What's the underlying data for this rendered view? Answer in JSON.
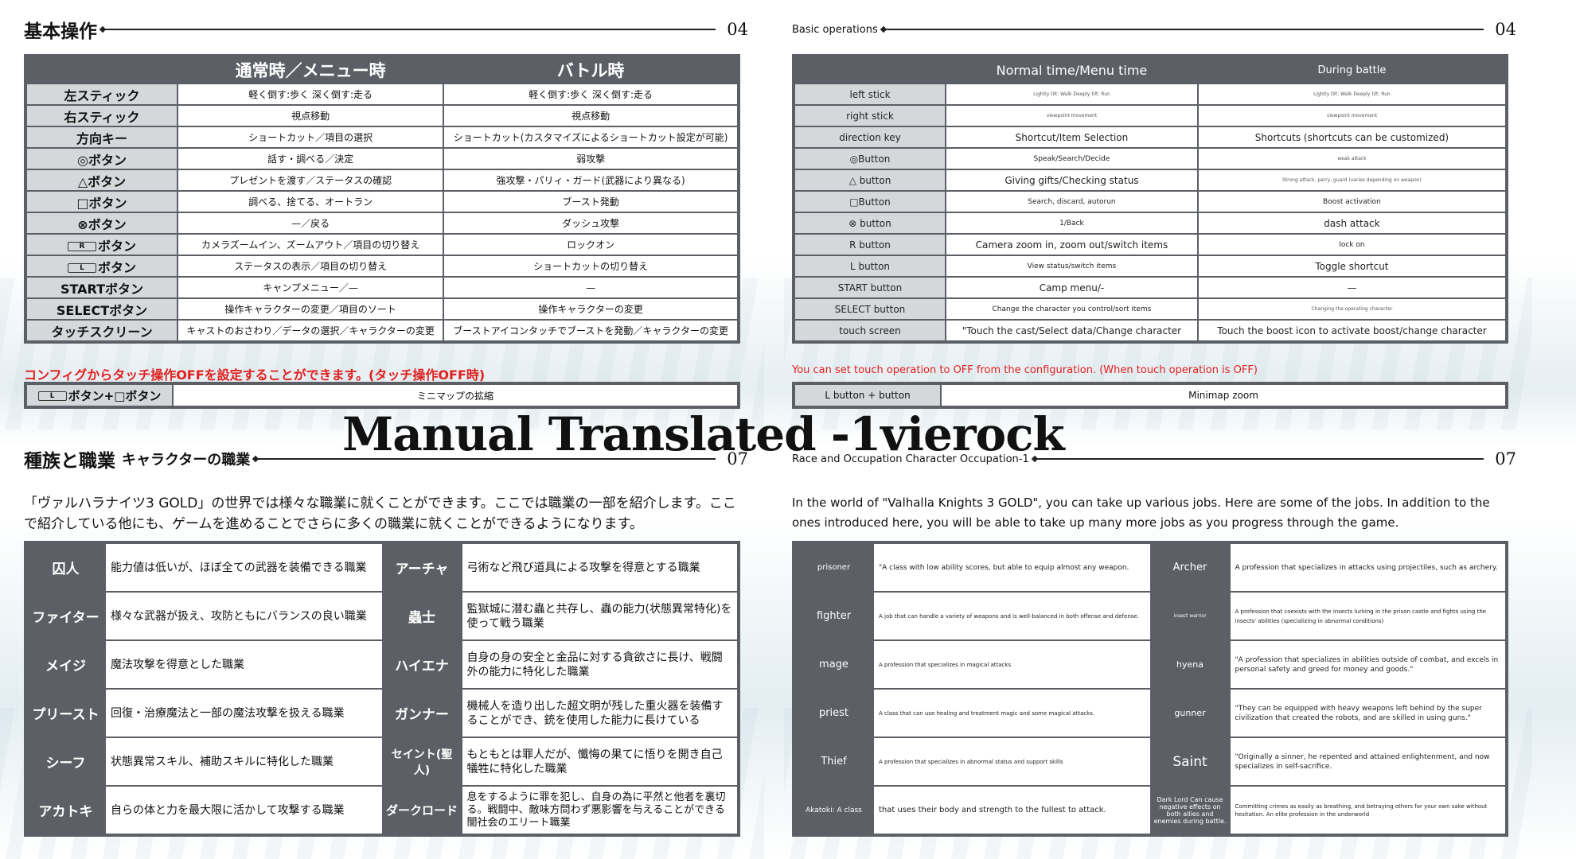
{
  "jp_ops": {
    "title": "基本操作",
    "page": "04",
    "col_normal": "通常時／メニュー時",
    "col_battle": "バトル時",
    "rows": [
      {
        "key": "左スティック",
        "normal": "軽く倒す:歩く 深く倒す:走る",
        "battle": "軽く倒す:歩く 深く倒す:走る"
      },
      {
        "key": "右スティック",
        "normal": "視点移動",
        "battle": "視点移動"
      },
      {
        "key": "方向キー",
        "normal": "ショートカット／項目の選択",
        "battle": "ショートカット(カスタマイズによるショートカット設定が可能)"
      },
      {
        "key": "◎ボタン",
        "normal": "話す・調べる／決定",
        "battle": "弱攻撃"
      },
      {
        "key": "△ボタン",
        "normal": "プレゼントを渡す／ステータスの確認",
        "battle": "強攻撃・パリィ・ガード(武器により異なる)"
      },
      {
        "key": "□ボタン",
        "normal": "調べる、捨てる、オートラン",
        "battle": "ブースト発動"
      },
      {
        "key": "⊗ボタン",
        "normal": "—／戻る",
        "battle": "ダッシュ攻撃"
      },
      {
        "key": "ボタン",
        "normal": "カメラズームイン、ズームアウト／項目の切り替え",
        "battle": "ロックオン"
      },
      {
        "key": "ボタン",
        "normal": "ステータスの表示／項目の切り替え",
        "battle": "ショートカットの切り替え"
      },
      {
        "key": "STARTボタン",
        "normal": "キャンプメニュー／—",
        "battle": "—"
      },
      {
        "key": "SELECTボタン",
        "normal": "操作キャラクターの変更／項目のソート",
        "battle": "操作キャラクターの変更"
      },
      {
        "key": "タッチスクリーン",
        "normal": "キャストのおさわり／データの選択／キャラクターの変更",
        "battle": "ブーストアイコンタッチでブーストを発動／キャラクターの変更"
      }
    ],
    "btn_r": "R",
    "btn_l": "L",
    "note": "コンフィグからタッチ操作OFFを設定することができます。(タッチ操作OFF時)",
    "extra_key": "ボタン+□ボタン",
    "extra_val": "ミニマップの拡縮"
  },
  "en_ops": {
    "title": "Basic operations",
    "page": "04",
    "col_normal": "Normal time/Menu time",
    "col_battle": "During battle",
    "rows": [
      {
        "key": "left stick",
        "normal": "Lightly tilt: Walk Deeply tilt: Run",
        "battle": "Lightly tilt: Walk Deeply tilt: Run"
      },
      {
        "key": "right stick",
        "normal": "viewpoint movement",
        "battle": "viewpoint movement"
      },
      {
        "key": "direction key",
        "normal": "Shortcut/Item Selection",
        "battle": "Shortcuts (shortcuts can be customized)"
      },
      {
        "key": "◎Button",
        "normal": "Speak/Search/Decide",
        "battle": "weak attack"
      },
      {
        "key": "△ button",
        "normal": "Giving gifts/Checking status",
        "battle": "Strong attack, parry, guard (varies depending on weapon)"
      },
      {
        "key": "□Button",
        "normal": "Search, discard, autorun",
        "battle": "Boost activation"
      },
      {
        "key": "⊗ button",
        "normal": "1/Back",
        "battle": "dash attack"
      },
      {
        "key": "R button",
        "normal": "Camera zoom in, zoom out/switch items",
        "battle": "lock on"
      },
      {
        "key": "L button",
        "normal": "View status/switch items",
        "battle": "Toggle shortcut"
      },
      {
        "key": "START button",
        "normal": "Camp menu/-",
        "battle": "—"
      },
      {
        "key": "SELECT button",
        "normal": "Change the character you control/sort items",
        "battle": "Changing the operating character"
      },
      {
        "key": "touch screen",
        "normal": "\"Touch the cast/Select data/Change character",
        "battle": "Touch the boost icon to activate boost/change character"
      }
    ],
    "note": "You can set touch operation to OFF from the configuration. (When touch operation is OFF)",
    "extra_key": "L button + button",
    "extra_val": "Minimap zoom"
  },
  "jp_jobs": {
    "title": "種族と職業",
    "subtitle": "キャラクターの職業",
    "page": "07",
    "intro": "「ヴァルハラナイツ3 GOLD」の世界では様々な職業に就くことができます。ここでは職業の一部を紹介します。ここで紹介している他にも、ゲームを進めることでさらに多くの職業に就くことができるようになります。",
    "rows": [
      {
        "j1": "囚人",
        "d1": "能力値は低いが、ほぼ全ての武器を装備できる職業",
        "j2": "アーチャ",
        "d2": "弓術など飛び道具による攻撃を得意とする職業"
      },
      {
        "j1": "ファイター",
        "d1": "様々な武器が扱え、攻防ともにバランスの良い職業",
        "j2": "蟲士",
        "d2": "監獄城に潜む蟲と共存し、蟲の能力(状態異常特化)を使って戦う職業"
      },
      {
        "j1": "メイジ",
        "d1": "魔法攻撃を得意とした職業",
        "j2": "ハイエナ",
        "d2": "自身の身の安全と金品に対する貪欲さに長け、戦闘外の能力に特化した職業"
      },
      {
        "j1": "プリースト",
        "d1": "回復・治療魔法と一部の魔法攻撃を扱える職業",
        "j2": "ガンナー",
        "d2": "機械人を造り出した超文明が残した重火器を装備することができ、銃を使用した能力に長けている"
      },
      {
        "j1": "シーフ",
        "d1": "状態異常スキル、補助スキルに特化した職業",
        "j2": "セイント(聖人)",
        "d2": "もともとは罪人だが、懺悔の果てに悟りを開き自己犠牲に特化した職業"
      },
      {
        "j1": "アカトキ",
        "d1": "自らの体と力を最大限に活かして攻撃する職業",
        "j2": "ダークロード",
        "d2": "息をするように罪を犯し、自身の為に平然と他者を裏切る。戦闘中、敵味方問わず悪影響を与えることができる闇社会のエリート職業"
      }
    ]
  },
  "en_jobs": {
    "title": "Race and Occupation Character Occupation-1",
    "page": "07",
    "intro": "In the world of \"Valhalla Knights 3 GOLD\", you can take up various jobs. Here are some of the jobs. In addition to the ones introduced here, you will be able to take up many more jobs as you progress through the game.",
    "rows": [
      {
        "j1": "prisoner",
        "d1": "\"A class with low ability scores, but able to equip almost any weapon.",
        "j2": "Archer",
        "d2": "A profession that specializes in attacks using projectiles, such as archery."
      },
      {
        "j1": "fighter",
        "d1": "A job that can handle a variety of weapons and is well-balanced in both offense and defense.",
        "j2": "insect warrior",
        "d2": "A profession that coexists with the insects lurking in the prison castle and fights using the insects' abilities (specializing in abnormal conditions)"
      },
      {
        "j1": "mage",
        "d1": "A profession that specializes in magical attacks",
        "j2": "hyena",
        "d2": "\"A profession that specializes in abilities outside of combat, and excels in personal safety and greed for money and goods.\""
      },
      {
        "j1": "priest",
        "d1": "A class that can use healing and treatment magic and some magical attacks.",
        "j2": "gunner",
        "d2": "\"They can be equipped with heavy weapons left behind by the super civilization that created the robots, and are skilled in using guns.\""
      },
      {
        "j1": "Thief",
        "d1": "A profession that specializes in abnormal status and support skills",
        "j2": "Saint",
        "d2": "\"Originally a sinner, he repented and attained enlightenment, and now specializes in self-sacrifice."
      },
      {
        "j1": "Akatoki: A class",
        "d1": "that uses their body and strength to the fullest to attack.",
        "j2": "Dark Lord Can cause negative effects on both allies and enemies during battle.",
        "d2": "Committing crimes as easily as breathing, and betraying others for your own sake without hesitation. An elite profession in the underworld"
      }
    ]
  },
  "watermark": "Manual Translated -1vierock"
}
